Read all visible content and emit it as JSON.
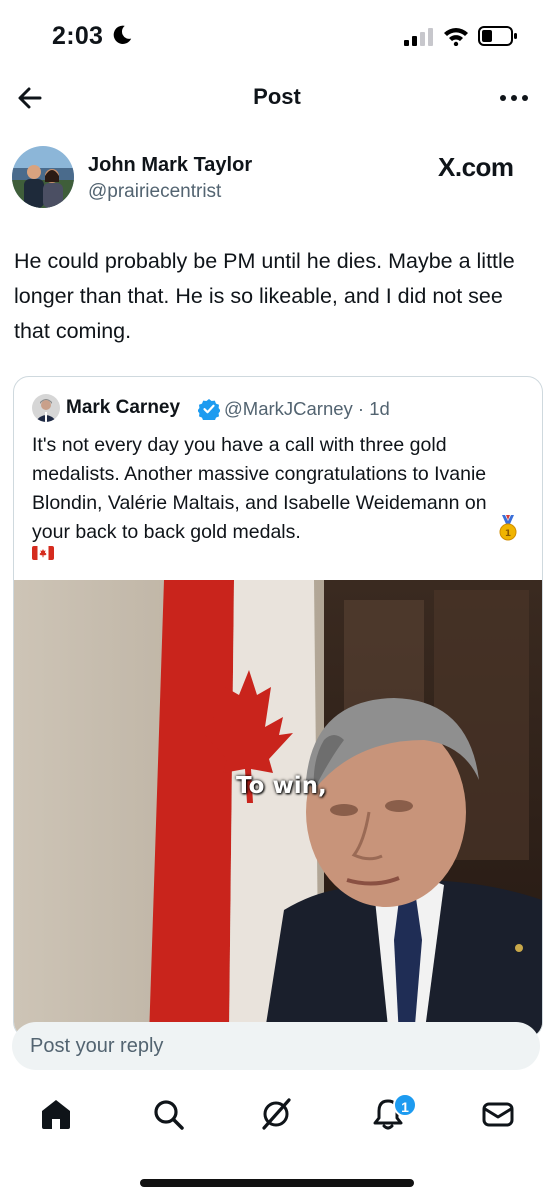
{
  "status_bar": {
    "time": "2:03",
    "icons": [
      "moon-icon",
      "signal-icon",
      "wifi-icon",
      "battery-icon"
    ]
  },
  "header": {
    "title": "Post",
    "back_icon": "arrow-left-icon",
    "more_icon": "more-horizontal-icon"
  },
  "post": {
    "author_name": "John Mark Taylor",
    "author_handle": "@prairiecentrist",
    "source": "X.com",
    "text": "He could probably be PM until he dies. Maybe a little longer than that. He is so likeable, and I did not see that coming."
  },
  "quoted_post": {
    "author_name": "Mark Carney",
    "verified": true,
    "handle_time": "@MarkJCarney · 1d",
    "text": "It's not every day you have a call with three gold medalists. Another massive congratulations to Ivanie Blondin, Valérie Maltais, and Isabelle Weidemann on your back to back gold medals.",
    "emojis": [
      "gold-medal-icon",
      "canada-flag-icon"
    ],
    "video_caption": "To win,"
  },
  "reply": {
    "placeholder": "Post your reply"
  },
  "bottom_nav": {
    "items": [
      "home-icon",
      "search-icon",
      "grok-icon",
      "notifications-icon",
      "messages-icon"
    ],
    "notification_count": "1"
  },
  "colors": {
    "accent": "#1d9bf0",
    "text_primary": "#0f1419",
    "text_secondary": "#536471",
    "flag_red": "#d52b1e"
  }
}
